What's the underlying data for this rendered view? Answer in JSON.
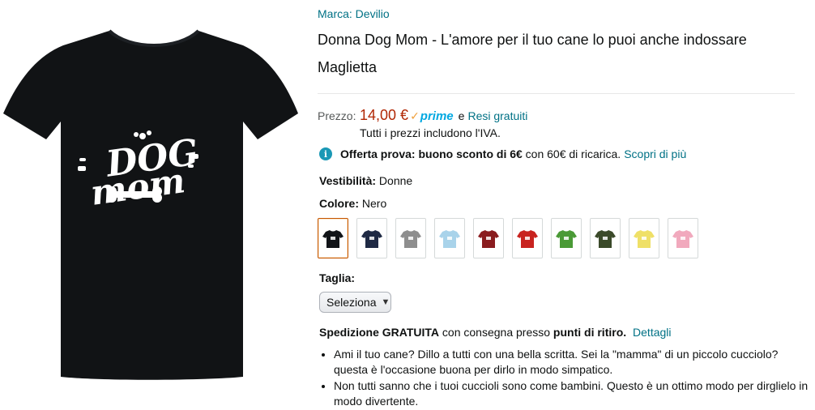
{
  "product": {
    "brand_label": "Marca: Devilio",
    "title": "Donna Dog Mom - L'amore per il tuo cane lo puoi anche indossare Maglietta",
    "image_text_top": "DOG",
    "image_text_bottom": "mom"
  },
  "price": {
    "label": "Prezzo:",
    "value": "14,00 €",
    "prime_check": "✓",
    "prime_label": "prime",
    "and": "e",
    "returns_link": "Resi gratuiti",
    "vat_note": "Tutti i prezzi includono l'IVA."
  },
  "offer": {
    "icon": "info-icon",
    "icon_glyph": "i",
    "bold_text": "Offerta prova: buono sconto di 6€",
    "text": " con 60€ di ricarica.",
    "link": "Scopri di più"
  },
  "fit": {
    "label": "Vestibilità:",
    "value": "Donne"
  },
  "color": {
    "label": "Colore:",
    "value": "Nero",
    "swatches": [
      {
        "name": "Nero",
        "hex": "#111418",
        "selected": true
      },
      {
        "name": "Blu navy",
        "hex": "#1f2a44"
      },
      {
        "name": "Grigio",
        "hex": "#8e8e8e"
      },
      {
        "name": "Azzurro",
        "hex": "#a9d3ea"
      },
      {
        "name": "Bordeaux",
        "hex": "#8a1c1f"
      },
      {
        "name": "Rosso",
        "hex": "#c8231f"
      },
      {
        "name": "Verde",
        "hex": "#4a9a36"
      },
      {
        "name": "Oliva",
        "hex": "#3b4a2a"
      },
      {
        "name": "Giallo",
        "hex": "#efe067"
      },
      {
        "name": "Rosa",
        "hex": "#f1a9bd"
      }
    ]
  },
  "size": {
    "label": "Taglia:",
    "selected": "Seleziona"
  },
  "shipping": {
    "bold1": "Spedizione GRATUITA",
    "text": " con consegna presso ",
    "bold2": "punti di ritiro.",
    "link": "Dettagli"
  },
  "bullets": [
    "Ami il tuo cane? Dillo a tutti con una bella scritta. Sei la \"mamma\" di un piccolo cucciolo? questa è l'occasione buona per dirlo in modo simpatico.",
    "Non tutti sanno che i tuoi cuccioli sono come bambini. Questo è un ottimo modo per dirglielo in modo divertente."
  ]
}
